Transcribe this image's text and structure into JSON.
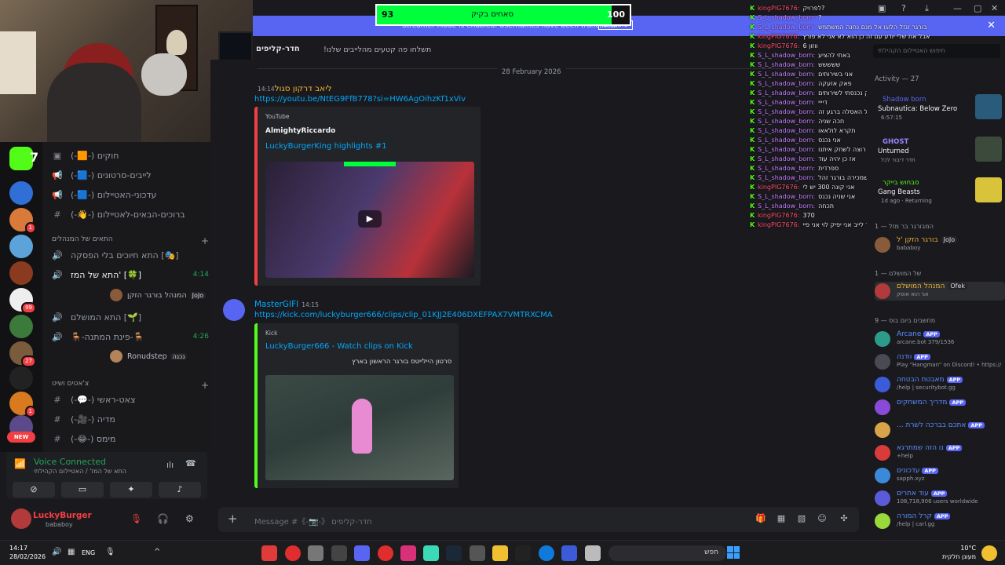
{
  "overlay": {
    "progress": {
      "current": "93",
      "label": "סאחים בקיק",
      "max": "100",
      "fraction": 0.93
    },
    "alert": {
      "text": "Streamer Mode is enabled. Usernames have been truncated.",
      "disable": "Disable"
    }
  },
  "header": {
    "channel_name": "חדר-קליפים",
    "topic": "!תשלחו פה קטעים מהלייבים שלנו"
  },
  "servers": {
    "badges": [
      "7",
      "1",
      "1",
      "1",
      "99",
      "1",
      "27",
      "1"
    ],
    "new_label": "NEW"
  },
  "sidebar": {
    "channels_top": [
      {
        "name": "(-🟧-) חוקים",
        "icon": "#"
      },
      {
        "name": "(-🟦-) לייבים-סרטונים",
        "icon": "📢"
      },
      {
        "name": "(-🟦-) עדכוני-האטיילום",
        "icon": "📢"
      },
      {
        "name": "(-👋-) ברוכים-הבאים-לאטיילום",
        "icon": "#"
      }
    ],
    "category_voice": "התאים של המנהלים",
    "voice_channels": [
      {
        "name": "התא חיוכים בלי הפסקה [🎭]",
        "time": ""
      },
      {
        "name": "התא של המז' [🍀]",
        "time": "4:14"
      },
      {
        "name": "התא המושלם [🌱]",
        "time": ""
      },
      {
        "name": "🪑-פינת המתנה-🪑",
        "time": "4:26"
      }
    ],
    "voice_users": [
      {
        "name": "המנהל בורגר הזקן",
        "tag": "JoJo"
      },
      {
        "name": "Ronudstep",
        "tag": "נכנה"
      }
    ],
    "category_chat": "צ'אטים ושיט",
    "channels_bottom": [
      {
        "name": "(-💬-) צאט-ראשי"
      },
      {
        "name": "(-🎥-) מדיה"
      },
      {
        "name": "(-😂-) מימס"
      }
    ]
  },
  "voice": {
    "status": "Voice Connected",
    "channel": "התא של המז' / האטיילום הקהילתי"
  },
  "user": {
    "name": "LuckyBurger",
    "status": "bababoy"
  },
  "main": {
    "date_divider": "28 February 2026",
    "messages": [
      {
        "author": "ליאב דרקון סגול",
        "time": "14:14",
        "link": "https://youtu.be/NtEG9FfB778?si=HW6AgOihzKf1xViv",
        "embed": {
          "provider": "YouTube",
          "author": "AlmightyRiccardo",
          "title": "LuckyBurgerKing highlights #1",
          "description": ""
        }
      },
      {
        "author": "MasterGIFI",
        "time": "14:15",
        "link": "https://kick.com/luckyburger666/clips/clip_01KJJ2E406DXEFPAX7VMTRXCMA",
        "embed": {
          "provider": "Kick",
          "author": "",
          "title": "LuckyBurger666 - Watch clips on Kick",
          "description": "סרטון היילייטס בורגר הראשון בארץ"
        }
      }
    ],
    "input_placeholder": "Message #《-📷-》 חדר-קליפים"
  },
  "chat": [
    {
      "user": "kingPIG7676:",
      "text": "לפרויק?",
      "c": 1
    },
    {
      "user": "S_L_shadow_born:",
      "text": "?",
      "c": 2
    },
    {
      "user": "S_L_shadow_born:",
      "text": "בורגר זנזל הלוגו אל מנם נחנה המשתמש",
      "c": 2
    },
    {
      "user": "kingPIG7676:",
      "text": "אבל את שלי יודע עם זה כן הוא לא אני לא פורץ",
      "c": 1
    },
    {
      "user": "kingPIG7676:",
      "text": "ווזון 6",
      "c": 1
    },
    {
      "user": "S_L_shadow_born:",
      "text": "באתי להציע",
      "c": 2
    },
    {
      "user": "S_L_shadow_born:",
      "text": "ששששש",
      "c": 2
    },
    {
      "user": "S_L_shadow_born:",
      "text": "אני בשירותים",
      "c": 2
    },
    {
      "user": "S_L_shadow_born:",
      "text": "פאק אזעקה",
      "c": 2
    },
    {
      "user": "S_L_shadow_born:",
      "text": "רק נכנסתי לשירותים",
      "c": 2
    },
    {
      "user": "S_L_shadow_born:",
      "text": "דיייי",
      "c": 2
    },
    {
      "user": "S_L_shadow_born:",
      "text": "אני על האסלה ברגע זה",
      "c": 2
    },
    {
      "user": "S_L_shadow_born:",
      "text": "חכה שניה",
      "c": 2
    },
    {
      "user": "S_L_shadow_born:",
      "text": "תקרא לולאאו",
      "c": 2
    },
    {
      "user": "S_L_shadow_born:",
      "text": "אני נכנס",
      "c": 2
    },
    {
      "user": "S_L_shadow_born:",
      "text": "אני שמח כשאני רוצה לשחק איתנו",
      "c": 2
    },
    {
      "user": "S_L_shadow_born:",
      "text": "אז כן יהיה עוד",
      "c": 2
    },
    {
      "user": "S_L_shadow_born:",
      "text": "ספרדית",
      "c": 2
    },
    {
      "user": "S_L_shadow_born:",
      "text": "אני שמכירה בורגר זהל",
      "c": 2
    },
    {
      "user": "kingPIG7676:",
      "text": "אני קונה 300 יש לי",
      "c": 1
    },
    {
      "user": "S_L_shadow_born:",
      "text": "אני שניה נכנס",
      "c": 2
    },
    {
      "user": "S_L_shadow_born:",
      "text": "תכחה",
      "c": 2
    },
    {
      "user": "kingPIG7676:",
      "text": "370",
      "c": 1
    },
    {
      "user": "kingPIG7676:",
      "text": "מתי אתה סוגר לייב אני יפיק לוי אני פיי",
      "c": 1
    }
  ],
  "members": {
    "search_placeholder": "חיפוש האטיילום הקהילתי",
    "activity_header": "Activity — 27",
    "activities": [
      {
        "title": "Shadow born",
        "game": "Subnautica: Below Zero",
        "sub": "6:57:15"
      },
      {
        "title": "GHOST",
        "game": "Unturned",
        "sub": "חדר דיבור לכל"
      },
      {
        "title": "סבחוש בייקר",
        "game": "Gang Beasts",
        "sub": "1d ago · Returning"
      }
    ],
    "groups": [
      "המבורגר בר מזל — 1",
      "של המושלם — 1",
      "מחשבים ביום בוס — 9"
    ],
    "group1": [
      {
        "name": "בורגר הזקן 'ל",
        "sub": "bababoy",
        "tag": "JoJo"
      }
    ],
    "group2": [
      {
        "name": "המנהל המושלם",
        "sub": "אני הוא אופק",
        "tag": "Ofek"
      }
    ],
    "apps": [
      {
        "name": "Arcane",
        "sub": "arcane.bot 379/1536",
        "color": "#2d9b8a"
      },
      {
        "name": "וודנה",
        "sub": "Play \"Hangman\" on Discord! • https://",
        "color": "#4a4a55"
      },
      {
        "name": "מאבטח הבטחה",
        "sub": "/help | securitybot.gg",
        "color": "#3b5bd9"
      },
      {
        "name": "מדריך המשחקים",
        "sub": "",
        "color": "#8a4ad9"
      },
      {
        "name": "... אתכם בברכה לשרת",
        "sub": "",
        "color": "#d9a34a"
      },
      {
        "name": "נו הזה שמתרגא",
        "sub": "+help",
        "color": "#d93b3b"
      },
      {
        "name": "עדכונים",
        "sub": "sapph.xyz",
        "color": "#3b8ad9"
      },
      {
        "name": "עוד אתרים",
        "sub": "108,718,906 users worldwide",
        "color": "#5b5bd9"
      },
      {
        "name": "קרל המורה",
        "sub": "/help | carl.gg",
        "color": "#9ad93b"
      }
    ],
    "app_tag": "APP"
  },
  "taskbar": {
    "time": "14:17",
    "date": "28/02/2026",
    "lang": "ENG",
    "search": "חפש",
    "weather_temp": "10°C",
    "weather_desc": "מעונן חלקית"
  }
}
